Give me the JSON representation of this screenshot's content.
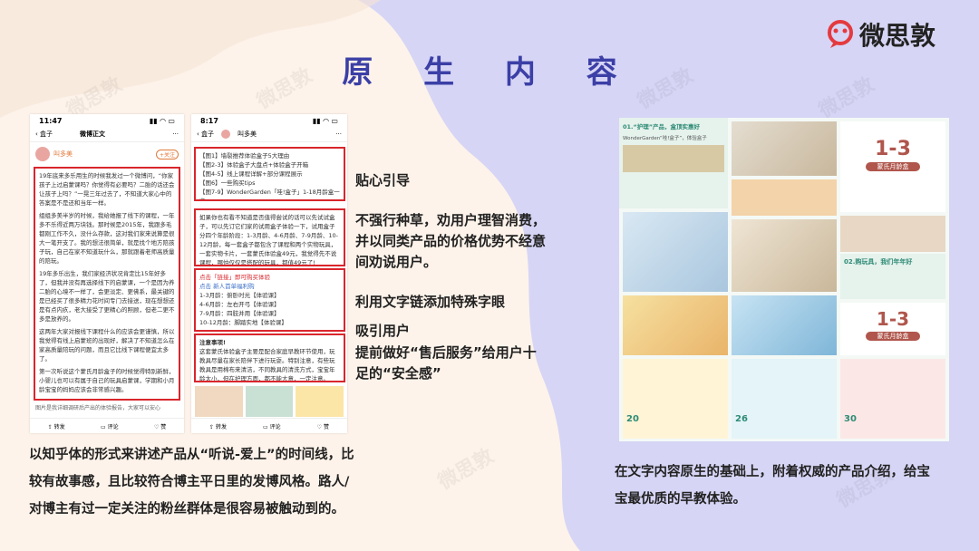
{
  "title": "原 生 内 容",
  "brand": {
    "name": "微思敦"
  },
  "phone1": {
    "time": "11:47",
    "back_label": "盒子",
    "nav_title": "微博正文",
    "author": "叫多美",
    "p1": "19年底来多乐用生的时候我发过一个微博问，“你家孩子上过启蒙课吗？你觉得有必要吗？二胎的话还会让孩子上吗？”一晃三年过去了，不知道大家心中的答案是不是还和当年一样。",
    "p2": "组组多美半岁的时候，我给她报了线下的课程，一年多不乐得近两万块钱。那时候是2015年，我跟多毛都刚工作不久，没什么存款，这对我们家来说算是很大一笔开支了。我的想法很简单，就是找个地方陪孩子玩，自己在家不知道玩什么，那就跟着老师高质量的陪玩。",
    "p3": "19年多乐出生，我们家经济状况肯定比15年好多了，但我并没有再选择线下的启蒙课，一个是因为养二胎的心境不一样了，会更淡定、更佛系，最关键的是已经买了很多精力花时间专门去接送，现在想想还是有点内疚，老大接受了更精心的照顾，但老二更不多是放养的。",
    "p4": "这两年大家对报线下课程什么的应该会更谨慎，所以我觉得有线上启蒙班的出现好，解决了不知道怎么在家高质量陪玩的问题，而且它比线下课程便宜太多了。",
    "p5": "第一次听说这个蒙氏月龄盒子的时候觉得特别新鲜，小婴儿也可以有属于自己的玩具启蒙课，学期和小月龄宝宝的妈妈应该会非常感兴趣。",
    "footer_text": "图片是我详细调研后产出的体验报告，大家可以安心",
    "actions": [
      "转发",
      "评论",
      "赞"
    ]
  },
  "phone2": {
    "time": "8:17",
    "back_label": "盒子",
    "author": "叫多美",
    "box1": [
      "【图1】墙裂推荐体验盒子5大理由",
      "【图2-3】体验盒子大盘点+体验盒子开箱",
      "【图4-5】线上课程详解+部分课程展示",
      "【图6】一些购买tips",
      "【图7-9】WonderGarden「哇!盒子」1-18月龄盒一览"
    ],
    "box2": "如果你也有看不知道是否值得尝试的话可以先试试盒子，可以先订它们家的试用盒子体验一下，试用盒子分四个年龄阶段：1-3月龄、4-6月龄、7-9月龄、10-12月龄，每一套盒子都包含了课程和两个实物玩具，一套实物卡片，一套蒙氏体验盒49元，我觉得先不说课程，哪怕仅仅是搭配的玩具，都值49元了!",
    "box3_title": "点击「链接」即可购买体验",
    "box3_sub": "点击 新人首单福利购",
    "box3_items": [
      "1-3月龄：俯卧时光【体验课】",
      "4-6月龄：左右开弓【体验课】",
      "7-9月龄：四肢并用【体验课】",
      "10-12月龄：脚踏实地【体验课】"
    ],
    "box4_title": "注意事项!",
    "box4": "这套蒙氏体验盒子主要是配合家庭早教环节使用，玩教具尽量在家长陪伴下进行玩耍。特别注意，有些玩教具是用棉布来清洁，不同教具的清洗方式，宝宝年龄太小，但在护理方面，都不能大意，一定注意。",
    "actions": [
      "转发",
      "评论",
      "赞"
    ]
  },
  "annotations": {
    "a1": "贴心引导",
    "a2": "不强行种草，劝用户理智消费，并以同类产品的价格优势不经意间劝说用户。",
    "a3": "利用文字链添加特殊字眼",
    "a4_line1": "吸引用户",
    "a4_line2": "提前做好“售后服务”给用户十足的“安全感”"
  },
  "left_caption": "以知乎体的形式来讲述产品从“听说-爱上”的时间线，比较有故事感，且比较符合博主平日里的发博风格。路人/对博主有过一定关注的粉丝群体是很容易被触动到的。",
  "right_caption": "在文字内容原生的基础上，附着权威的产品介绍，给宝宝最优质的早教体验。",
  "collage": {
    "c1_head": "01.“护理”产品，盒顶实惠好",
    "c1_sub": "WonderGarden“哇!盒子”，体验盒子",
    "c2_head": "1-3",
    "c2_sub": "蒙氏月龄盒",
    "c3_head": "02.购玩具，我们年年好",
    "c4_head": "1-3",
    "c4_sub": "蒙氏月龄盒",
    "c5_labels": [
      "20",
      "26",
      "30"
    ]
  },
  "colors": {
    "accent": "#3b3fa6",
    "red": "#d9262c",
    "brand_red": "#e43a3f",
    "teal": "#5aa79a"
  }
}
